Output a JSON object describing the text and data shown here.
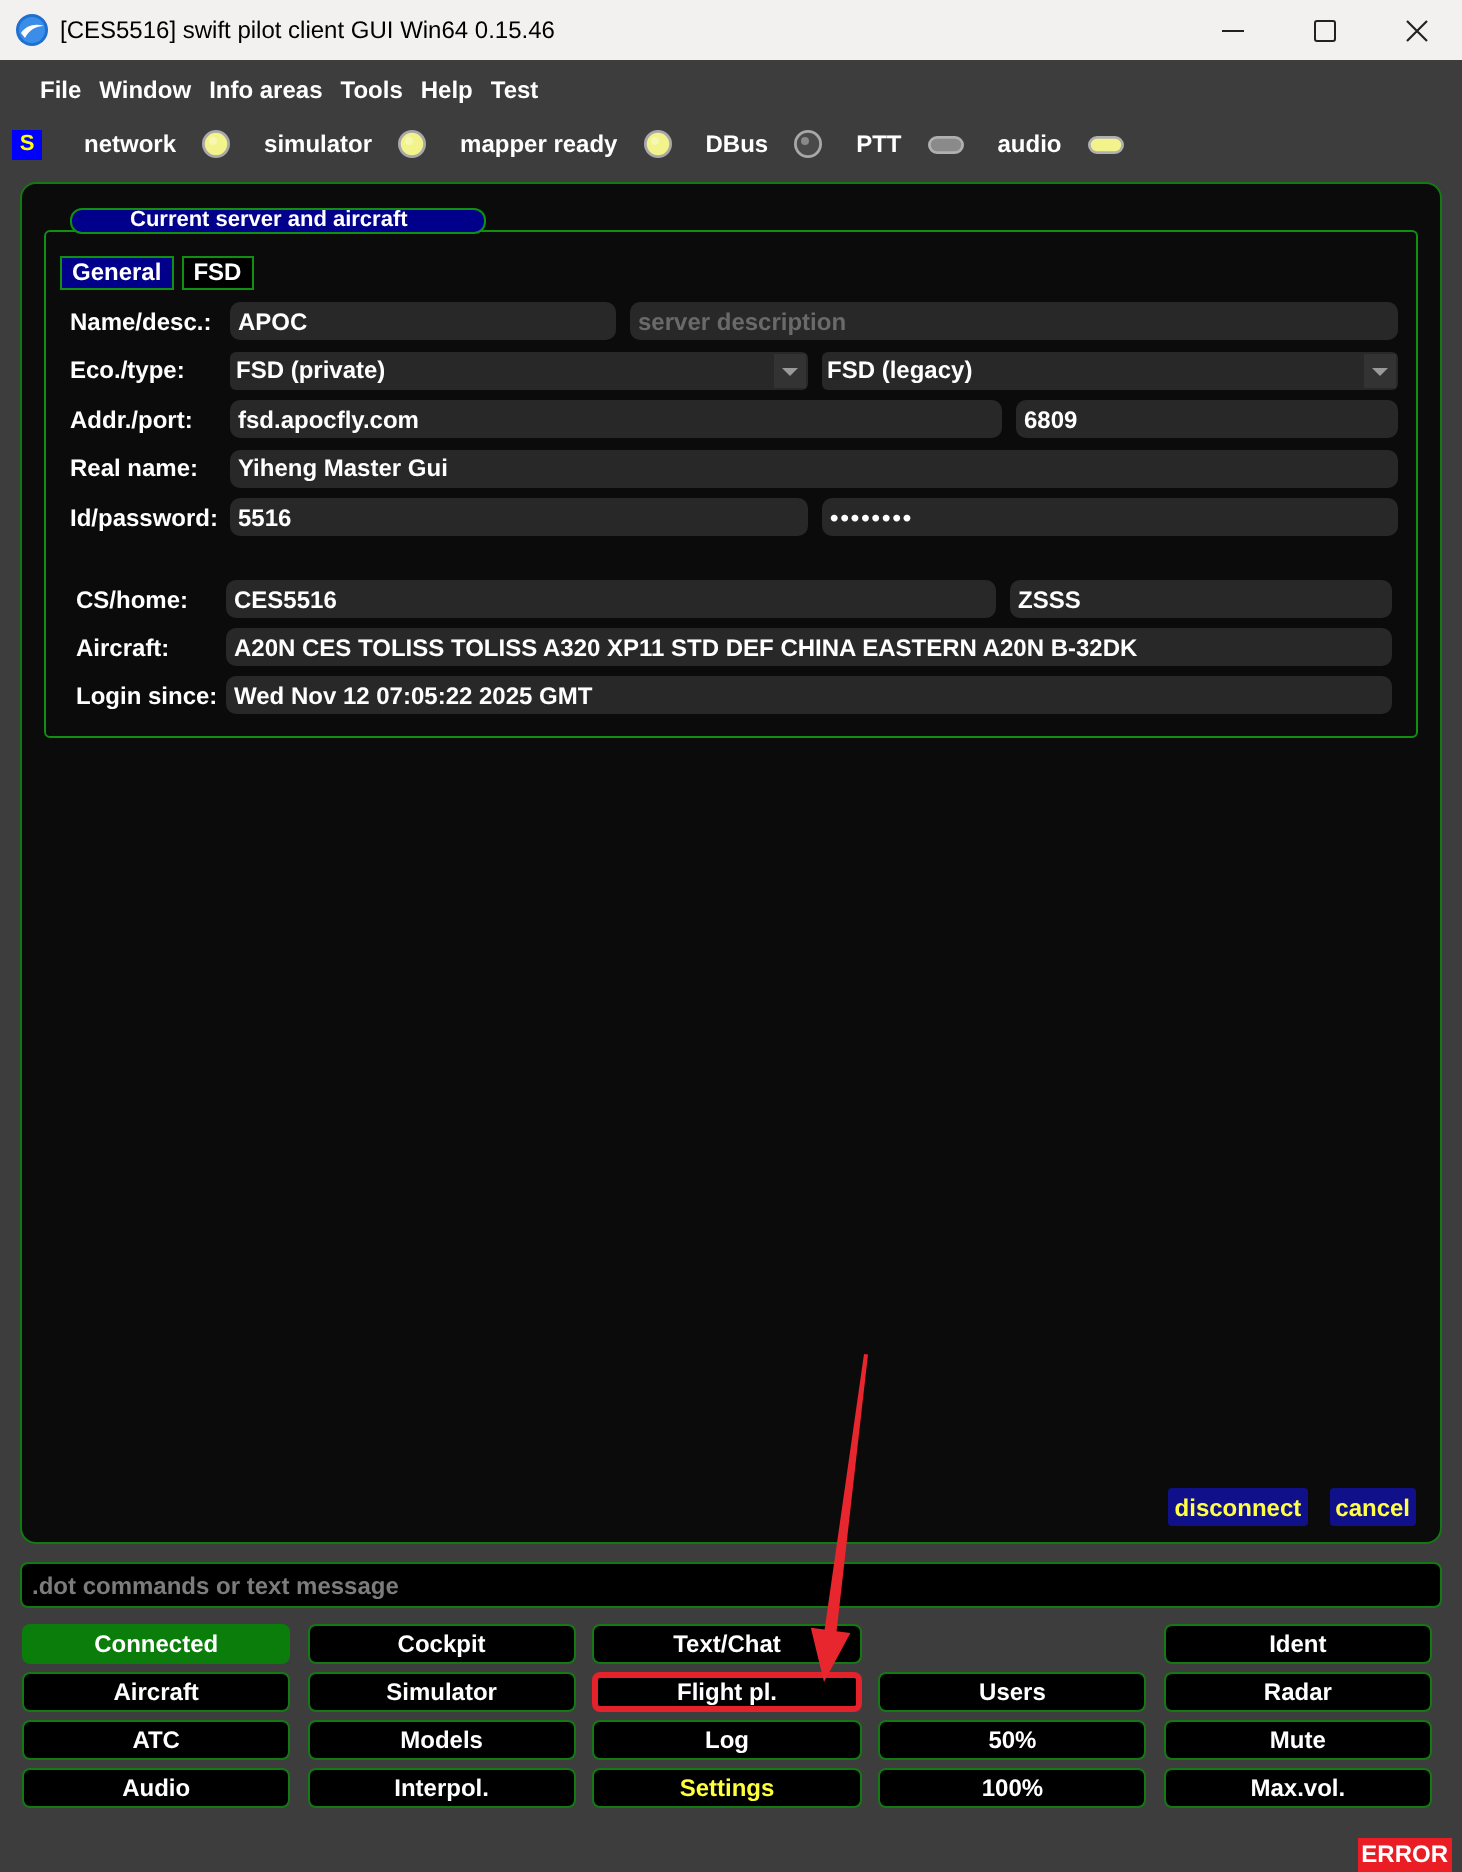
{
  "window": {
    "title": "[CES5516] swift pilot client GUI Win64 0.15.46"
  },
  "menu": [
    "File",
    "Window",
    "Info areas",
    "Tools",
    "Help",
    "Test"
  ],
  "status_bar": {
    "logo": "S",
    "indicators": [
      {
        "label": "network",
        "on": true,
        "kind": "round"
      },
      {
        "label": "simulator",
        "on": true,
        "kind": "round"
      },
      {
        "label": "mapper ready",
        "on": true,
        "kind": "round"
      },
      {
        "label": "DBus",
        "on": false,
        "kind": "round"
      },
      {
        "label": "PTT",
        "on": false,
        "kind": "pill"
      },
      {
        "label": "audio",
        "on": true,
        "kind": "pill"
      }
    ]
  },
  "server_group": {
    "title": "Current server and aircraft",
    "tabs": [
      {
        "label": "General",
        "selected": true
      },
      {
        "label": "FSD",
        "selected": false
      }
    ],
    "server_rows": [
      {
        "label": "Name/desc.:",
        "fields": [
          {
            "kind": "text",
            "value": "APOC"
          },
          {
            "kind": "text",
            "placeholder": "server description"
          }
        ]
      },
      {
        "label": "Eco./type:",
        "fields": [
          {
            "kind": "combo",
            "value": "FSD (private)"
          },
          {
            "kind": "combo",
            "value": "FSD (legacy)"
          }
        ]
      },
      {
        "label": "Addr./port:",
        "fields": [
          {
            "kind": "text",
            "value": "fsd.apocfly.com"
          },
          {
            "kind": "text",
            "value": "6809"
          }
        ]
      },
      {
        "label": "Real name:",
        "fields": [
          {
            "kind": "text",
            "value": "Yiheng Master Gui"
          }
        ]
      },
      {
        "label": "Id/password:",
        "fields": [
          {
            "kind": "text",
            "value": "5516"
          },
          {
            "kind": "password",
            "value": "••••••••"
          }
        ]
      }
    ],
    "aircraft_rows": [
      {
        "label": "CS/home:",
        "fields": [
          {
            "kind": "text",
            "value": "CES5516"
          },
          {
            "kind": "text",
            "value": "ZSSS"
          }
        ]
      },
      {
        "label": "Aircraft:",
        "fields": [
          {
            "kind": "text",
            "value": "A20N CES TOLISS TOLISS A320 XP11 STD DEF CHINA EASTERN A20N B-32DK"
          }
        ]
      },
      {
        "label": "Login since:",
        "fields": [
          {
            "kind": "text",
            "value": "Wed Nov 12 07:05:22 2025 GMT"
          }
        ]
      }
    ]
  },
  "panel_actions": [
    "disconnect",
    "cancel"
  ],
  "command_line": {
    "placeholder": ".dot commands or text message"
  },
  "button_columns": [
    [
      {
        "label": "Connected",
        "kind": "connected",
        "highlighted": false
      },
      {
        "label": "Aircraft",
        "kind": "normal",
        "highlighted": false
      },
      {
        "label": "ATC",
        "kind": "normal",
        "highlighted": false
      },
      {
        "label": "Audio",
        "kind": "normal",
        "highlighted": false
      }
    ],
    [
      {
        "label": "Cockpit",
        "kind": "normal",
        "highlighted": false
      },
      {
        "label": "Simulator",
        "kind": "normal",
        "highlighted": false
      },
      {
        "label": "Models",
        "kind": "normal",
        "highlighted": false
      },
      {
        "label": "Interpol.",
        "kind": "normal",
        "highlighted": false
      }
    ],
    [
      {
        "label": "Text/Chat",
        "kind": "normal",
        "highlighted": false
      },
      {
        "label": "Flight pl.",
        "kind": "normal",
        "highlighted": true
      },
      {
        "label": "Log",
        "kind": "normal",
        "highlighted": false
      },
      {
        "label": "Settings",
        "kind": "notice",
        "highlighted": false
      }
    ],
    [
      {
        "label": "Users",
        "kind": "normal",
        "highlighted": false
      },
      {
        "label": "50%",
        "kind": "normal",
        "highlighted": false
      },
      {
        "label": "100%",
        "kind": "normal",
        "highlighted": false
      }
    ],
    [
      {
        "label": "Ident",
        "kind": "normal",
        "highlighted": false
      },
      {
        "label": "Radar",
        "kind": "normal",
        "highlighted": false
      },
      {
        "label": "Mute",
        "kind": "normal",
        "highlighted": false
      },
      {
        "label": "Max.vol.",
        "kind": "normal",
        "highlighted": false
      }
    ]
  ],
  "error_badge": "ERROR"
}
